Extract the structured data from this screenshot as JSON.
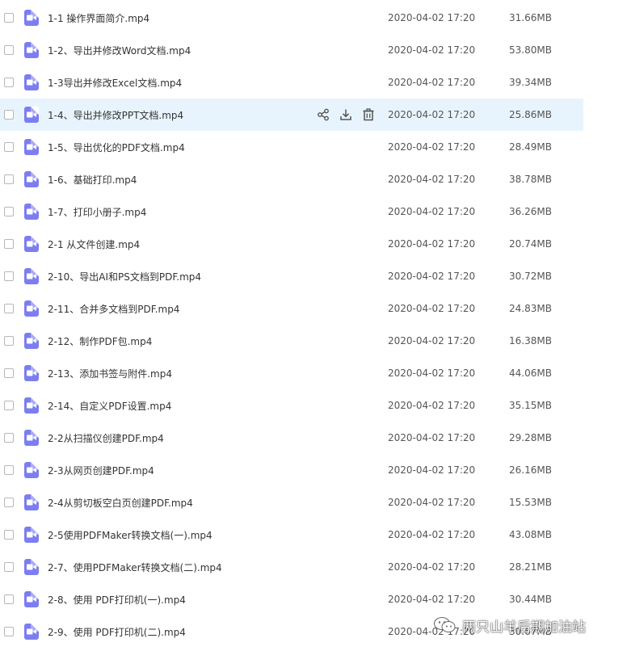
{
  "colors": {
    "file_icon": "#7c7ef0",
    "hover_row_bg": "#e8f4fd",
    "action_icon": "#555555"
  },
  "row_actions": [
    "share-icon",
    "download-icon",
    "delete-icon"
  ],
  "hovered_row_index": 3,
  "files": [
    {
      "name": "1-1 操作界面简介.mp4",
      "date": "2020-04-02 17:20",
      "size": "31.66MB"
    },
    {
      "name": "1-2、导出并修改Word文档.mp4",
      "date": "2020-04-02 17:20",
      "size": "53.80MB"
    },
    {
      "name": "1-3导出并修改Excel文档.mp4",
      "date": "2020-04-02 17:20",
      "size": "39.34MB"
    },
    {
      "name": "1-4、导出并修改PPT文档.mp4",
      "date": "2020-04-02 17:20",
      "size": "25.86MB"
    },
    {
      "name": "1-5、导出优化的PDF文档.mp4",
      "date": "2020-04-02 17:20",
      "size": "28.49MB"
    },
    {
      "name": "1-6、基础打印.mp4",
      "date": "2020-04-02 17:20",
      "size": "38.78MB"
    },
    {
      "name": "1-7、打印小册子.mp4",
      "date": "2020-04-02 17:20",
      "size": "36.26MB"
    },
    {
      "name": "2-1 从文件创建.mp4",
      "date": "2020-04-02 17:20",
      "size": "20.74MB"
    },
    {
      "name": "2-10、导出AI和PS文档到PDF.mp4",
      "date": "2020-04-02 17:20",
      "size": "30.72MB"
    },
    {
      "name": "2-11、合并多文档到PDF.mp4",
      "date": "2020-04-02 17:20",
      "size": "24.83MB"
    },
    {
      "name": "2-12、制作PDF包.mp4",
      "date": "2020-04-02 17:20",
      "size": "16.38MB"
    },
    {
      "name": "2-13、添加书签与附件.mp4",
      "date": "2020-04-02 17:20",
      "size": "44.06MB"
    },
    {
      "name": "2-14、自定义PDF设置.mp4",
      "date": "2020-04-02 17:20",
      "size": "35.15MB"
    },
    {
      "name": "2-2从扫描仪创建PDF.mp4",
      "date": "2020-04-02 17:20",
      "size": "29.28MB"
    },
    {
      "name": "2-3从网页创建PDF.mp4",
      "date": "2020-04-02 17:20",
      "size": "26.16MB"
    },
    {
      "name": "2-4从剪切板空白页创建PDF.mp4",
      "date": "2020-04-02 17:20",
      "size": "15.53MB"
    },
    {
      "name": "2-5使用PDFMaker转换文档(一).mp4",
      "date": "2020-04-02 17:20",
      "size": "43.08MB"
    },
    {
      "name": "2-7、使用PDFMaker转换文档(二).mp4",
      "date": "2020-04-02 17:20",
      "size": "28.21MB"
    },
    {
      "name": "2-8、使用 PDF打印机(一).mp4",
      "date": "2020-04-02 17:20",
      "size": "30.44MB"
    },
    {
      "name": "2-9、使用 PDF打印机(二).mp4",
      "date": "2020-04-02 17:20",
      "size": "30.67MB"
    }
  ],
  "watermark": {
    "text": "两只山羊后期加油站"
  }
}
